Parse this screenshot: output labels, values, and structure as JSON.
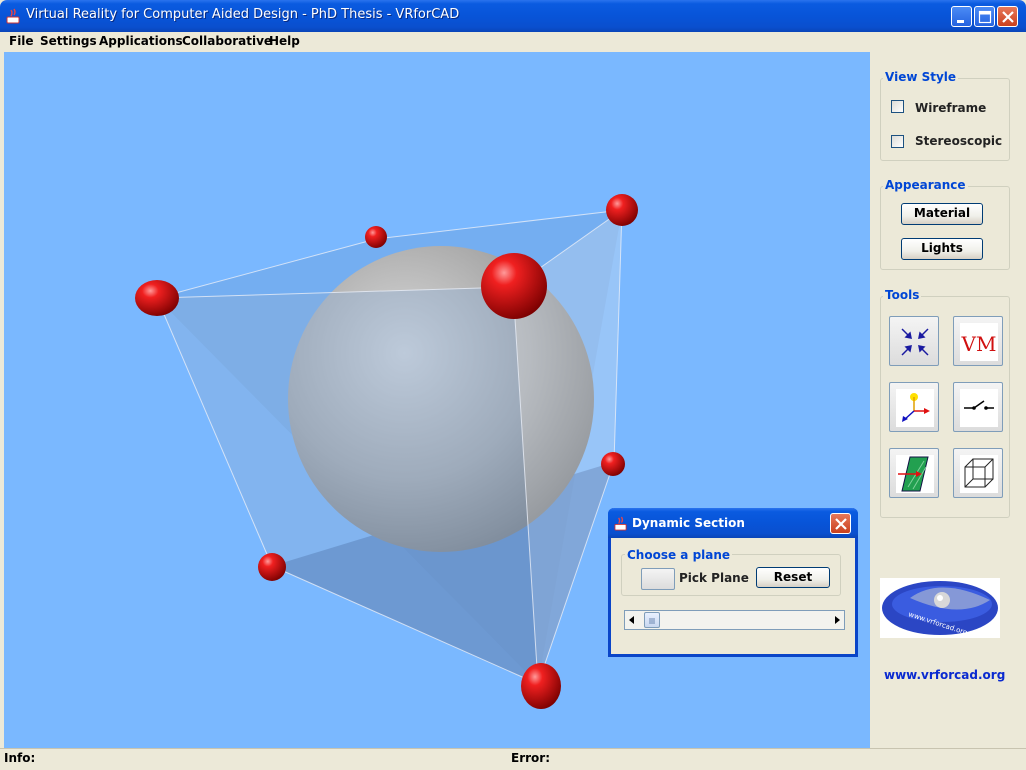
{
  "window": {
    "title": "Virtual Reality for Computer Aided Design - PhD Thesis  - VRforCAD",
    "minimize_icon": "minimize-icon",
    "maximize_icon": "maximize-icon",
    "close_icon": "close-icon"
  },
  "menubar": {
    "items": [
      "File",
      "Settings",
      "Applications",
      "Collaborative",
      "Help"
    ]
  },
  "viewport": {
    "background": "#7ab8ff",
    "scene": "sphere-with-transparent-tetrahedron",
    "sphere_color": "#bdbdbd",
    "handle_color": "#d41010"
  },
  "view_style": {
    "title": "View Style",
    "wireframe_label": "Wireframe",
    "wireframe_checked": false,
    "stereo_label": "Stereoscopic",
    "stereo_checked": false
  },
  "appearance": {
    "title": "Appearance",
    "material_label": "Material",
    "lights_label": "Lights"
  },
  "tools": {
    "title": "Tools",
    "buttons": [
      "move-arrows-icon",
      "vm-icon",
      "axes-icon",
      "switch-icon",
      "section-plane-icon",
      "wireframe-cube-icon"
    ],
    "vm_text": "VM"
  },
  "site": {
    "url": "www.vrforcad.org",
    "logo_text": "www.vrforcad.org"
  },
  "statusbar": {
    "info_label": "Info:",
    "error_label": "Error:"
  },
  "dialog": {
    "title": "Dynamic Section",
    "group_title": "Choose a plane",
    "pick_label": "Pick Plane",
    "reset_label": "Reset",
    "slider_value": 0.03
  },
  "colors": {
    "accent": "#0046d5",
    "titlebar": "#0854d8",
    "panel": "#ece9d8"
  }
}
